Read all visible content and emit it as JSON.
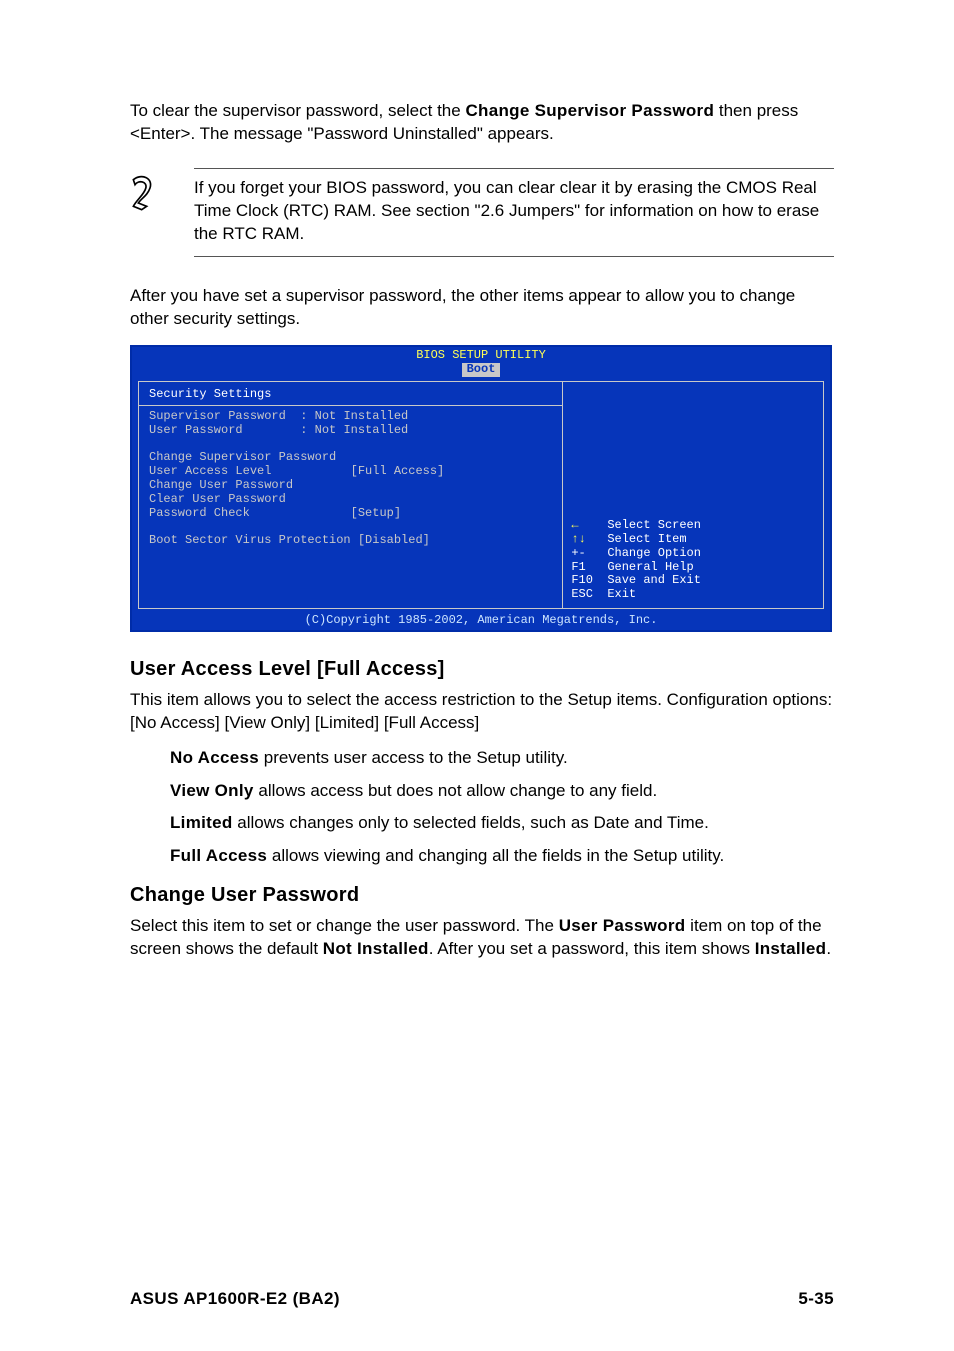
{
  "intro": {
    "pre": "To clear the supervisor password, select the ",
    "bold1": "Change Supervisor Password",
    "post": " then press <Enter>. The message \"Password Uninstalled\" appears."
  },
  "note": "If you forget your BIOS password, you can clear clear it by erasing the CMOS Real Time Clock (RTC) RAM. See section \"2.6  Jumpers\" for information on how to erase the RTC RAM.",
  "para2": "After you have set a supervisor password, the other items appear to allow you to change other security settings.",
  "bios": {
    "title": "BIOS SETUP UTILITY",
    "tab": "Boot",
    "section_head": "Security Settings",
    "supervisor_label": "Supervisor Password",
    "supervisor_value": ": Not Installed",
    "user_label": "User Password",
    "user_value": ": Not Installed",
    "change_sup": "Change Supervisor Password",
    "user_access_label": "User Access Level",
    "user_access_value": "[Full Access]",
    "change_user": "Change User Password",
    "clear_user": "Clear User Password",
    "pw_check_label": "Password Check",
    "pw_check_value": "[Setup]",
    "boot_sector": "Boot Sector Virus Protection [Disabled]",
    "help": {
      "l1k": "←",
      "l1t": "Select Screen",
      "l2k": "↑↓",
      "l2t": "Select Item",
      "l3k": "+-",
      "l3t": "Change Option",
      "l4k": "F1",
      "l4t": "General Help",
      "l5k": "F10",
      "l5t": "Save and Exit",
      "l6k": "ESC",
      "l6t": "Exit"
    },
    "footer": "(C)Copyright 1985-2002, American Megatrends, Inc."
  },
  "ual_head": "User Access Level [Full Access]",
  "ual_body": "This item allows you to select the access restriction to the Setup items. Configuration options: [No Access] [View Only] [Limited] [Full Access]",
  "opts": {
    "no_access_b": "No Access",
    "no_access_t": " prevents user access to the Setup utility.",
    "view_only_b": "View Only",
    "view_only_t": " allows access but does not allow change to any field.",
    "limited_b": "Limited",
    "limited_t": " allows changes only to selected fields, such as Date and Time.",
    "full_access_b": "Full Access",
    "full_access_t": " allows viewing and changing all the fields in the Setup utility."
  },
  "cup_head": "Change User Password",
  "cup": {
    "t1": "Select this item to set or change the user password. The ",
    "b1": "User Password",
    "t2": " item on top of the screen shows the default ",
    "b2": "Not Installed",
    "t3": ". After you set a password, this item shows ",
    "b3": "Installed",
    "t4": "."
  },
  "footer_left": "ASUS AP1600R-E2 (BA2)",
  "footer_right": "5-35"
}
